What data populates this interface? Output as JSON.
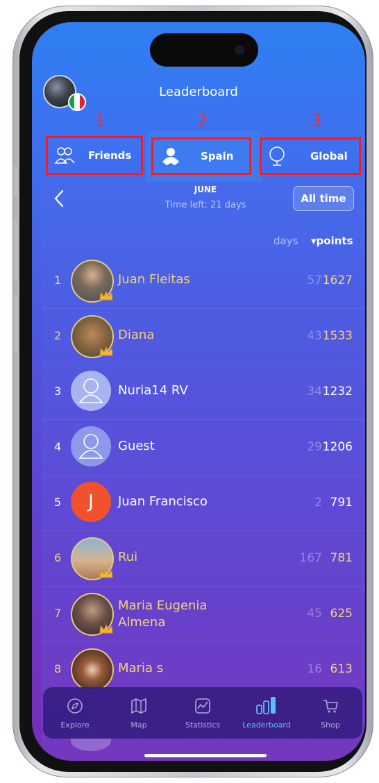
{
  "header": {
    "title": "Leaderboard"
  },
  "annotations": [
    "1",
    "2",
    "3"
  ],
  "tabs": [
    {
      "label": "Friends",
      "icon": "friends-icon",
      "active": false
    },
    {
      "label": "Spain",
      "icon": "user-location-icon",
      "active": true
    },
    {
      "label": "Global",
      "icon": "globe-icon",
      "active": false
    }
  ],
  "period": {
    "month": "JUNE",
    "time_left": "Time left: 21 days",
    "all_time_label": "All time"
  },
  "columns": {
    "days": "days",
    "points": "▾points"
  },
  "rows": [
    {
      "rank": "1",
      "name": "Juan  Fleitas",
      "days": "57",
      "points": "1627"
    },
    {
      "rank": "2",
      "name": "Diana",
      "days": "43",
      "points": "1533"
    },
    {
      "rank": "3",
      "name": "Nuria14  RV",
      "days": "34",
      "points": "1232"
    },
    {
      "rank": "4",
      "name": "Guest",
      "days": "29",
      "points": "1206"
    },
    {
      "rank": "5",
      "name": "Juan Francisco",
      "days": "2",
      "points": "791",
      "initial": "J"
    },
    {
      "rank": "6",
      "name": "Rui",
      "days": "167",
      "points": "781"
    },
    {
      "rank": "7",
      "name_line1": "Maria Eugenia",
      "name_line2": "Almena",
      "days": "45",
      "points": "625"
    },
    {
      "rank": "8",
      "name": "Maria s",
      "days": "16",
      "points": "613"
    }
  ],
  "nav": [
    {
      "label": "Explore",
      "icon": "compass-icon"
    },
    {
      "label": "Map",
      "icon": "map-icon"
    },
    {
      "label": "Statistics",
      "icon": "statistics-icon"
    },
    {
      "label": "Leaderboard",
      "icon": "leaderboard-icon",
      "active": true
    },
    {
      "label": "Shop",
      "icon": "cart-icon"
    }
  ],
  "colors": {
    "accent_gold": "#f5d27a",
    "annotation_red": "#ff1a1a",
    "active_nav": "#5ec4f3"
  }
}
